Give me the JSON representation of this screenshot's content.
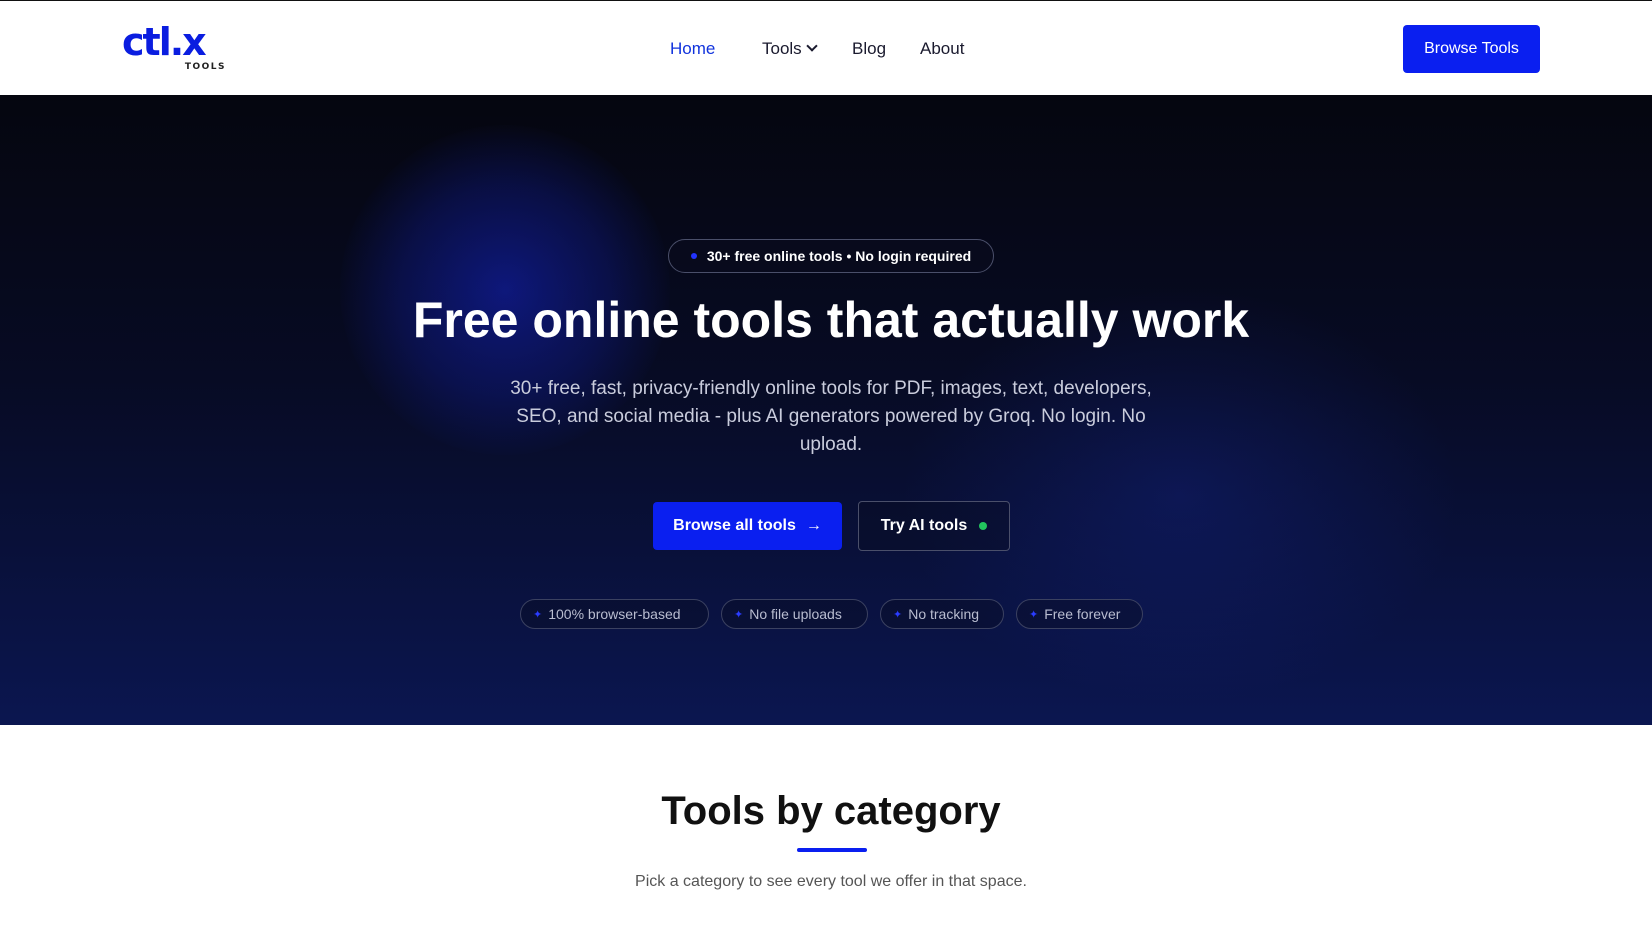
{
  "header": {
    "logo_text": "ctl.x",
    "logo_sub": "TOOLS",
    "nav": [
      {
        "label": "Home",
        "active": true
      },
      {
        "label": "Tools",
        "has_dropdown": true
      },
      {
        "label": "Blog"
      },
      {
        "label": "About"
      }
    ],
    "cta_label": "Browse Tools"
  },
  "hero": {
    "pill_text": "30+ free online tools • No login required",
    "title": "Free online tools that actually work",
    "subtitle": "30+ free, fast, privacy-friendly online tools for PDF, images, text, developers, SEO, and social media - plus AI generators powered by Groq. No login. No upload.",
    "primary_cta": "Browse all tools",
    "secondary_cta": "Try AI tools",
    "features": [
      "100% browser-based",
      "No file uploads",
      "No tracking",
      "Free forever"
    ]
  },
  "categories": {
    "title": "Tools by category",
    "subtitle": "Pick a category to see every tool we offer in that space."
  },
  "colors": {
    "accent": "#0a1ff0",
    "hero_bg": "#070b24",
    "status_green": "#22c55e"
  }
}
